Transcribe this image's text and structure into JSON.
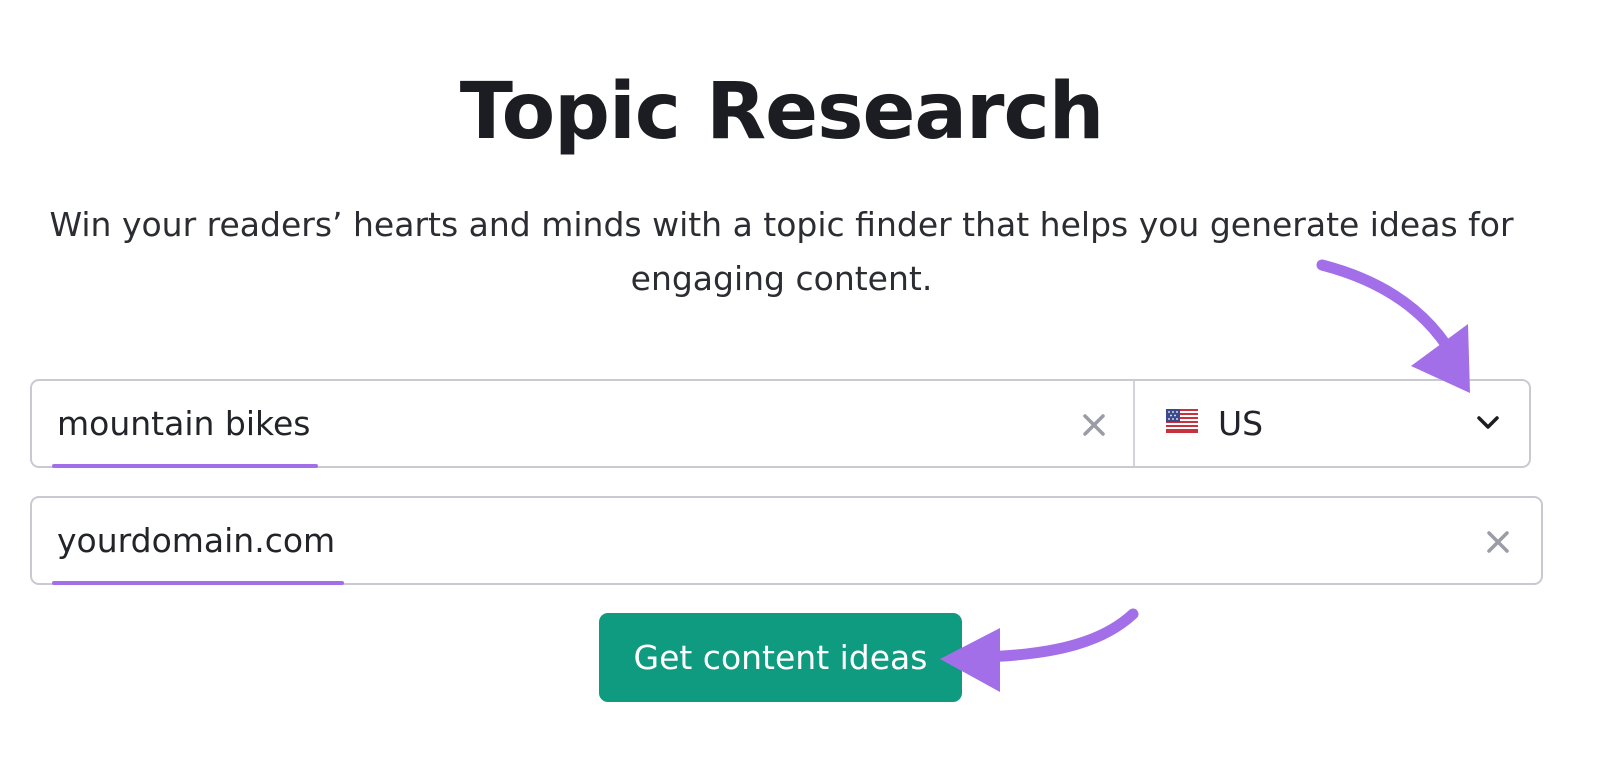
{
  "header": {
    "title": "Topic Research",
    "subtitle": "Win your readers’ hearts and minds with a topic finder that helps you generate ideas for engaging content."
  },
  "form": {
    "keyword": {
      "value": "mountain bikes"
    },
    "country": {
      "selected": "US",
      "flag": "us-flag-icon"
    },
    "domain": {
      "value": "yourdomain.com"
    },
    "submit_label": "Get content ideas"
  },
  "colors": {
    "primary_button": "#0f9b7f",
    "annotation_purple": "#a36fe8",
    "field_border": "#c9cad1",
    "clear_icon": "#9a9ca6"
  },
  "icons": {
    "keyword_clear": "close-icon",
    "domain_clear": "close-icon",
    "country_dropdown": "chevron-down-icon"
  }
}
